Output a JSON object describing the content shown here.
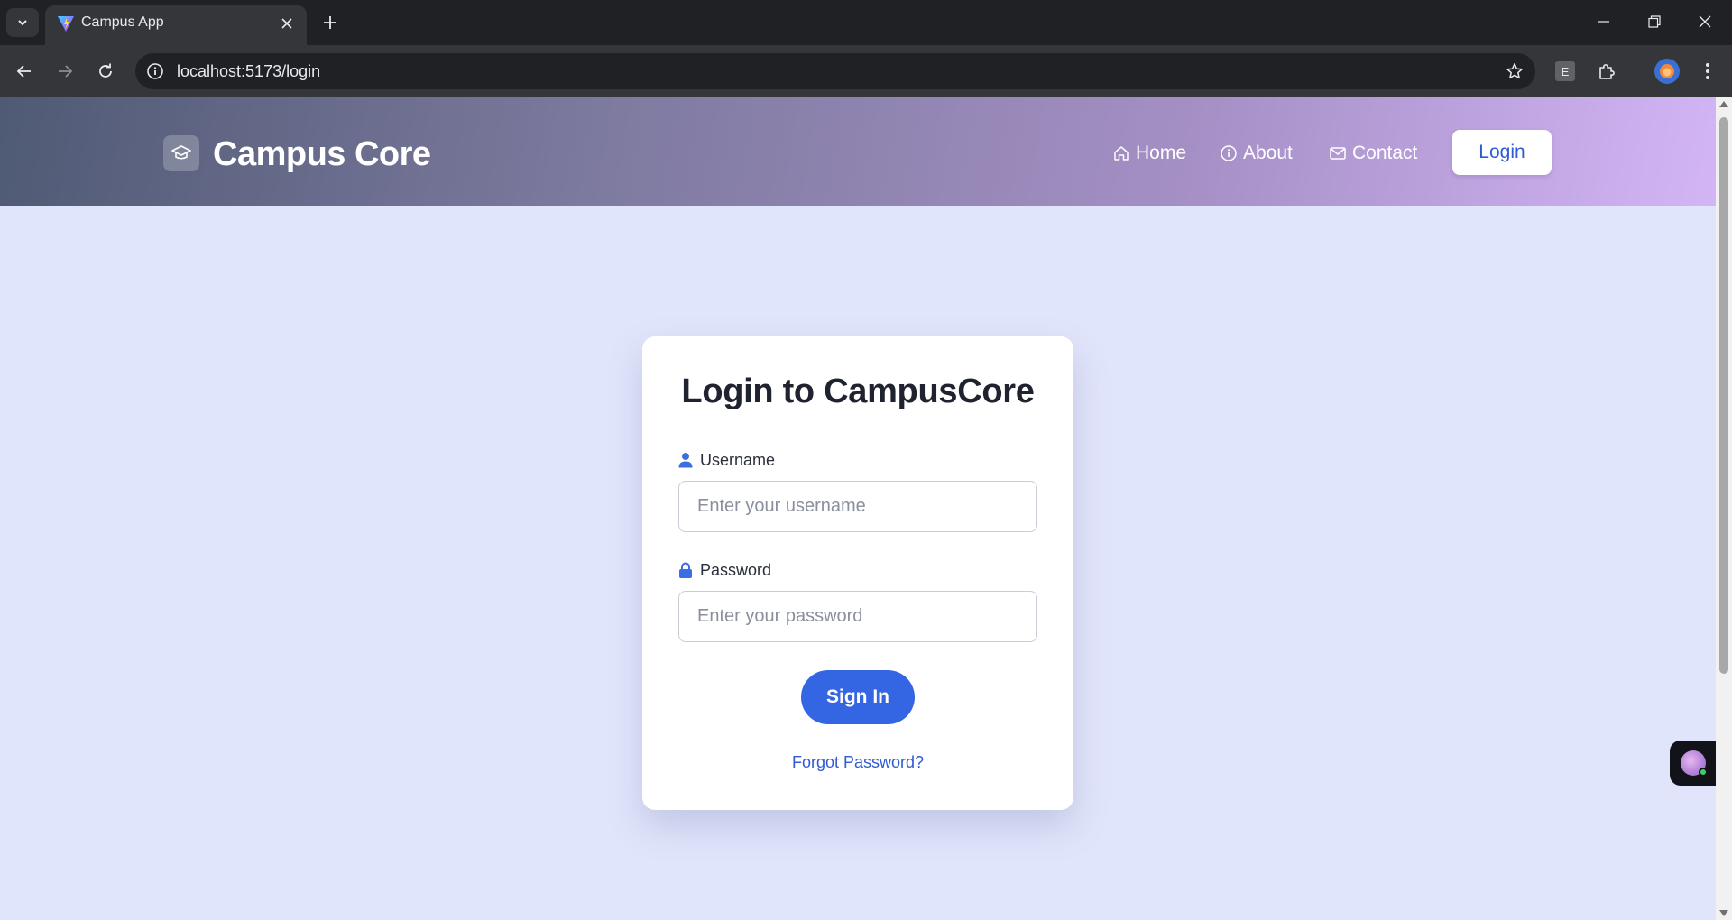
{
  "browser": {
    "tab_title": "Campus App",
    "url": "localhost:5173/login",
    "extension_badge": "E"
  },
  "navbar": {
    "brand": "Campus Core",
    "links": [
      {
        "label": "Home",
        "icon": "home-icon"
      },
      {
        "label": "About",
        "icon": "info-icon"
      },
      {
        "label": "Contact",
        "icon": "mail-icon"
      }
    ],
    "login_label": "Login"
  },
  "login_card": {
    "title": "Login to CampusCore",
    "username_label": "Username",
    "username_placeholder": "Enter your username",
    "password_label": "Password",
    "password_placeholder": "Enter your password",
    "submit_label": "Sign In",
    "forgot_label": "Forgot Password?"
  },
  "colors": {
    "accent": "#3465e3",
    "link": "#2f5bd3",
    "page_bg": "#e1e5fb",
    "navbar_start": "#4f5a74",
    "navbar_end": "#d3b5f6"
  }
}
